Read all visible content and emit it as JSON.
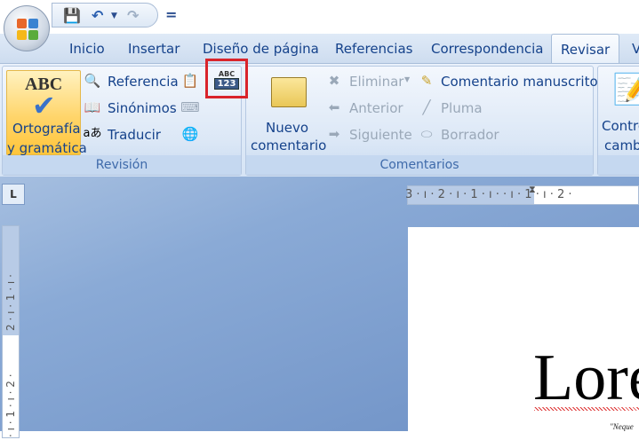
{
  "qat": {
    "customize_icon": "="
  },
  "tabs": [
    "Inicio",
    "Insertar",
    "Diseño de página",
    "Referencias",
    "Correspondencia",
    "Revisar",
    "V"
  ],
  "ribbon": {
    "revision": {
      "label": "Revisión",
      "spell_line1": "Ortografía",
      "spell_line2": "y gramática",
      "spell_icon_text": "ABC",
      "reference": "Referencia",
      "synonyms": "Sinónimos",
      "translate": "Traducir",
      "wordcount_icon_top": "ABC",
      "wordcount_icon_bottom": "123"
    },
    "comentarios": {
      "label": "Comentarios",
      "new_line1": "Nuevo",
      "new_line2": "comentario",
      "delete": "Eliminar",
      "previous": "Anterior",
      "next": "Siguiente",
      "ink_comment": "Comentario manuscrito",
      "pen": "Pluma",
      "eraser": "Borrador"
    },
    "track": {
      "line1": "Contro",
      "line2": "cambi"
    }
  },
  "ruler": {
    "tab_selector": "L",
    "horizontal": "3 · ı · 2 · ı · 1 · ı ·   · ı · 1 · ı · 2 ·",
    "vertical_top": "2 · ı · 1 · ı ·",
    "vertical_bottom": "· ı · 1 · ı · 2 ·"
  },
  "document": {
    "title": "Lore",
    "quote": "\"Neque"
  }
}
